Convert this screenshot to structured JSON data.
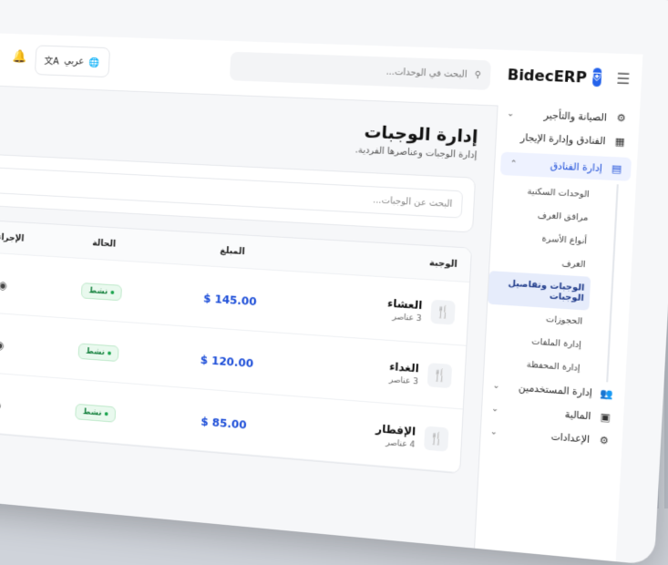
{
  "brand": {
    "name": "BidecERP"
  },
  "topbar": {
    "search_placeholder": "البحث في الوحدات...",
    "language": "عربي"
  },
  "sidebar": {
    "groups": [
      {
        "label": "الصيانة والتأجير",
        "icon": "wrench-icon"
      },
      {
        "label": "الفنادق وإدارة الإيجار",
        "icon": "building-icon"
      },
      {
        "label": "إدارة الفنادق",
        "icon": "hotel-icon"
      }
    ],
    "submenu": [
      {
        "label": "الوحدات السكنية"
      },
      {
        "label": "مرافق الغرف"
      },
      {
        "label": "أنواع الأسرة"
      },
      {
        "label": "الغرف"
      },
      {
        "label": "الوجبات وتفاصيل الوجبات"
      },
      {
        "label": "الحجوزات"
      },
      {
        "label": "إدارة الملفات"
      },
      {
        "label": "إدارة المحفظة"
      }
    ],
    "bottom": [
      {
        "label": "إدارة المستخدمين",
        "icon": "users-icon"
      },
      {
        "label": "المالية",
        "icon": "finance-icon"
      },
      {
        "label": "الإعدادات",
        "icon": "settings-icon"
      }
    ]
  },
  "page": {
    "title": "إدارة الوجبات",
    "subtitle": "إدارة الوجبات وعناصرها الفردية.",
    "filter_placeholder": "البحث عن الوجبات..."
  },
  "table": {
    "headers": {
      "meal": "الوجبة",
      "amount": "المبلغ",
      "status": "الحالة",
      "actions": "الإجراءات"
    },
    "rows": [
      {
        "name": "العشاء",
        "items": "3 عناصر",
        "amount": "$ 145.00",
        "status": "نشط"
      },
      {
        "name": "الغداء",
        "items": "3 عناصر",
        "amount": "$ 120.00",
        "status": "نشط"
      },
      {
        "name": "الإفطار",
        "items": "4 عناصر",
        "amount": "$ 85.00",
        "status": "نشط"
      }
    ]
  }
}
